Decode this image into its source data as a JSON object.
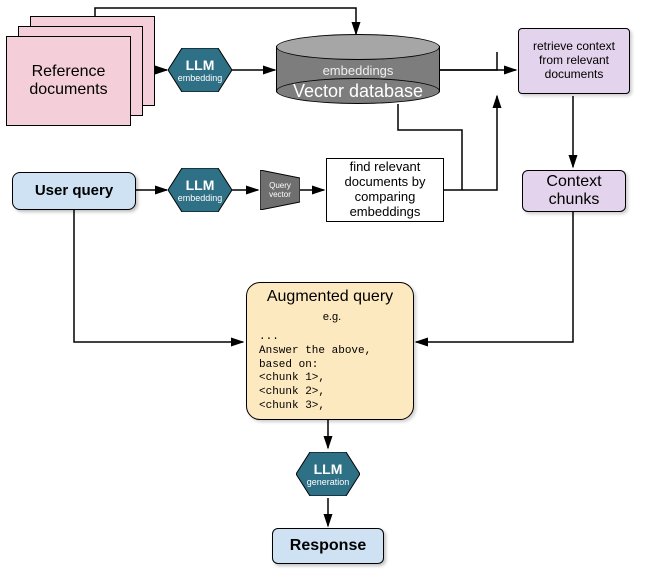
{
  "refdocs_label": "Reference documents",
  "userquery_label": "User query",
  "llm_label": "LLM",
  "llm_embedding_sub": "embedding",
  "llm_generation_sub": "generation",
  "vector_db_small": "embeddings",
  "vector_db_label": "Vector database",
  "query_vector_label": "Query vector",
  "find_relevant_text": "find relevant documents by comparing embeddings",
  "retrieve_text": "retrieve context from relevant documents",
  "context_chunks_label": "Context chunks",
  "augmented_title": "Augmented query",
  "augmented_eg": "e.g.",
  "augmented_body": "...\nAnswer the above,\nbased on:\n<chunk 1>,\n<chunk 2>,\n<chunk 3>,",
  "response_label": "Response"
}
